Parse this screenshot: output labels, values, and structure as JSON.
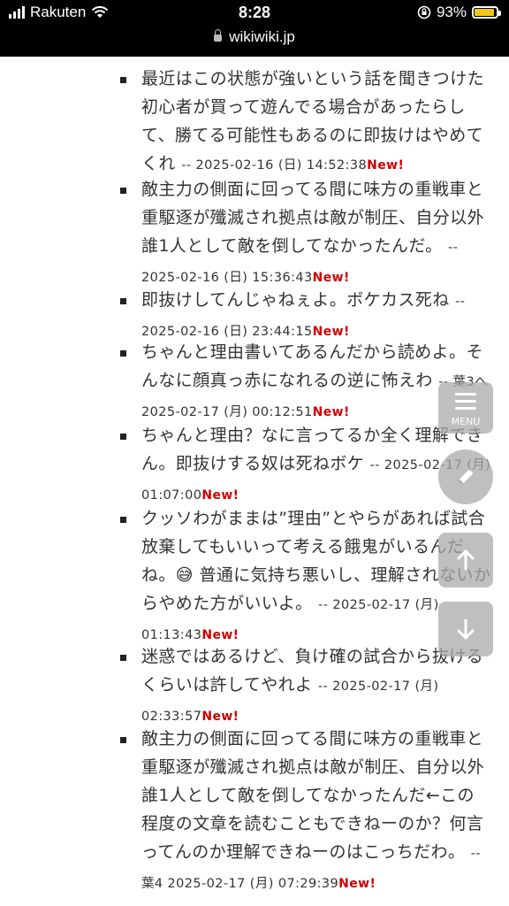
{
  "status_bar": {
    "carrier": "Rakuten",
    "time": "8:28",
    "battery": "93%",
    "url": "wikiwiki.jp",
    "battery_level": 0.93
  },
  "comments": [
    {
      "text": "最近はこの状態が強いという話を聞きつけた初心者が買って遊んでる場合があったらして、勝てる可能性もあるのに即抜けはやめてくれ",
      "meta": "-- 2025-02-16 (日) 14:52:38",
      "new": "New!"
    },
    {
      "text": "敵主力の側面に回ってる間に味方の重戦車と重駆逐が殲滅され拠点は敵が制圧、自分以外誰1人として敵を倒してなかったんだ。",
      "meta": "-- 2025-02-16 (日) 15:36:43",
      "new": "New!"
    },
    {
      "text": "即抜けしてんじゃねぇよ。ボケカス死ね",
      "meta": "-- 2025-02-16 (日) 23:44:15",
      "new": "New!"
    },
    {
      "text": "ちゃんと理由書いてあるんだから読めよ。そんなに顔真っ赤になれるの逆に怖えわ",
      "meta": "-- 葉3へ 2025-02-17 (月) 00:12:51",
      "new": "New!"
    },
    {
      "text": "ちゃんと理由？なに言ってるか全く理解できん。即抜けする奴は死ねボケ",
      "meta": "-- 2025-02-17 (月) 01:07:00",
      "new": "New!"
    },
    {
      "text": "クッソわがままは”理由”とやらがあれば試合放棄してもいいって考える餓鬼がいるんだね。😅 普通に気持ち悪いし、理解されないからやめた方がいいよ。",
      "meta": "-- 2025-02-17 (月) 01:13:43",
      "new": "New!"
    },
    {
      "text": "迷惑ではあるけど、負け確の試合から抜けるくらいは許してやれよ",
      "meta": "-- 2025-02-17 (月) 02:33:57",
      "new": "New!"
    },
    {
      "text": "敵主力の側面に回ってる間に味方の重戦車と重駆逐が殲滅され拠点は敵が制圧、自分以外誰1人として敵を倒してなかったんだ←この程度の文章を読むこともできねーのか？何言ってんのか理解できねーのはこっちだわ。",
      "meta": "-- 葉4 2025-02-17 (月) 07:29:39",
      "new": "New!"
    }
  ],
  "fabs": {
    "menu_label": "MENU",
    "menu_icon": "hamburger-icon",
    "edit_icon": "pencil-icon",
    "up_icon": "arrow-up-icon",
    "down_icon": "arrow-down-icon"
  },
  "colors": {
    "new_badge": "#d00000",
    "status_bar_bg": "#000000",
    "battery_fill": "#f5c518"
  }
}
